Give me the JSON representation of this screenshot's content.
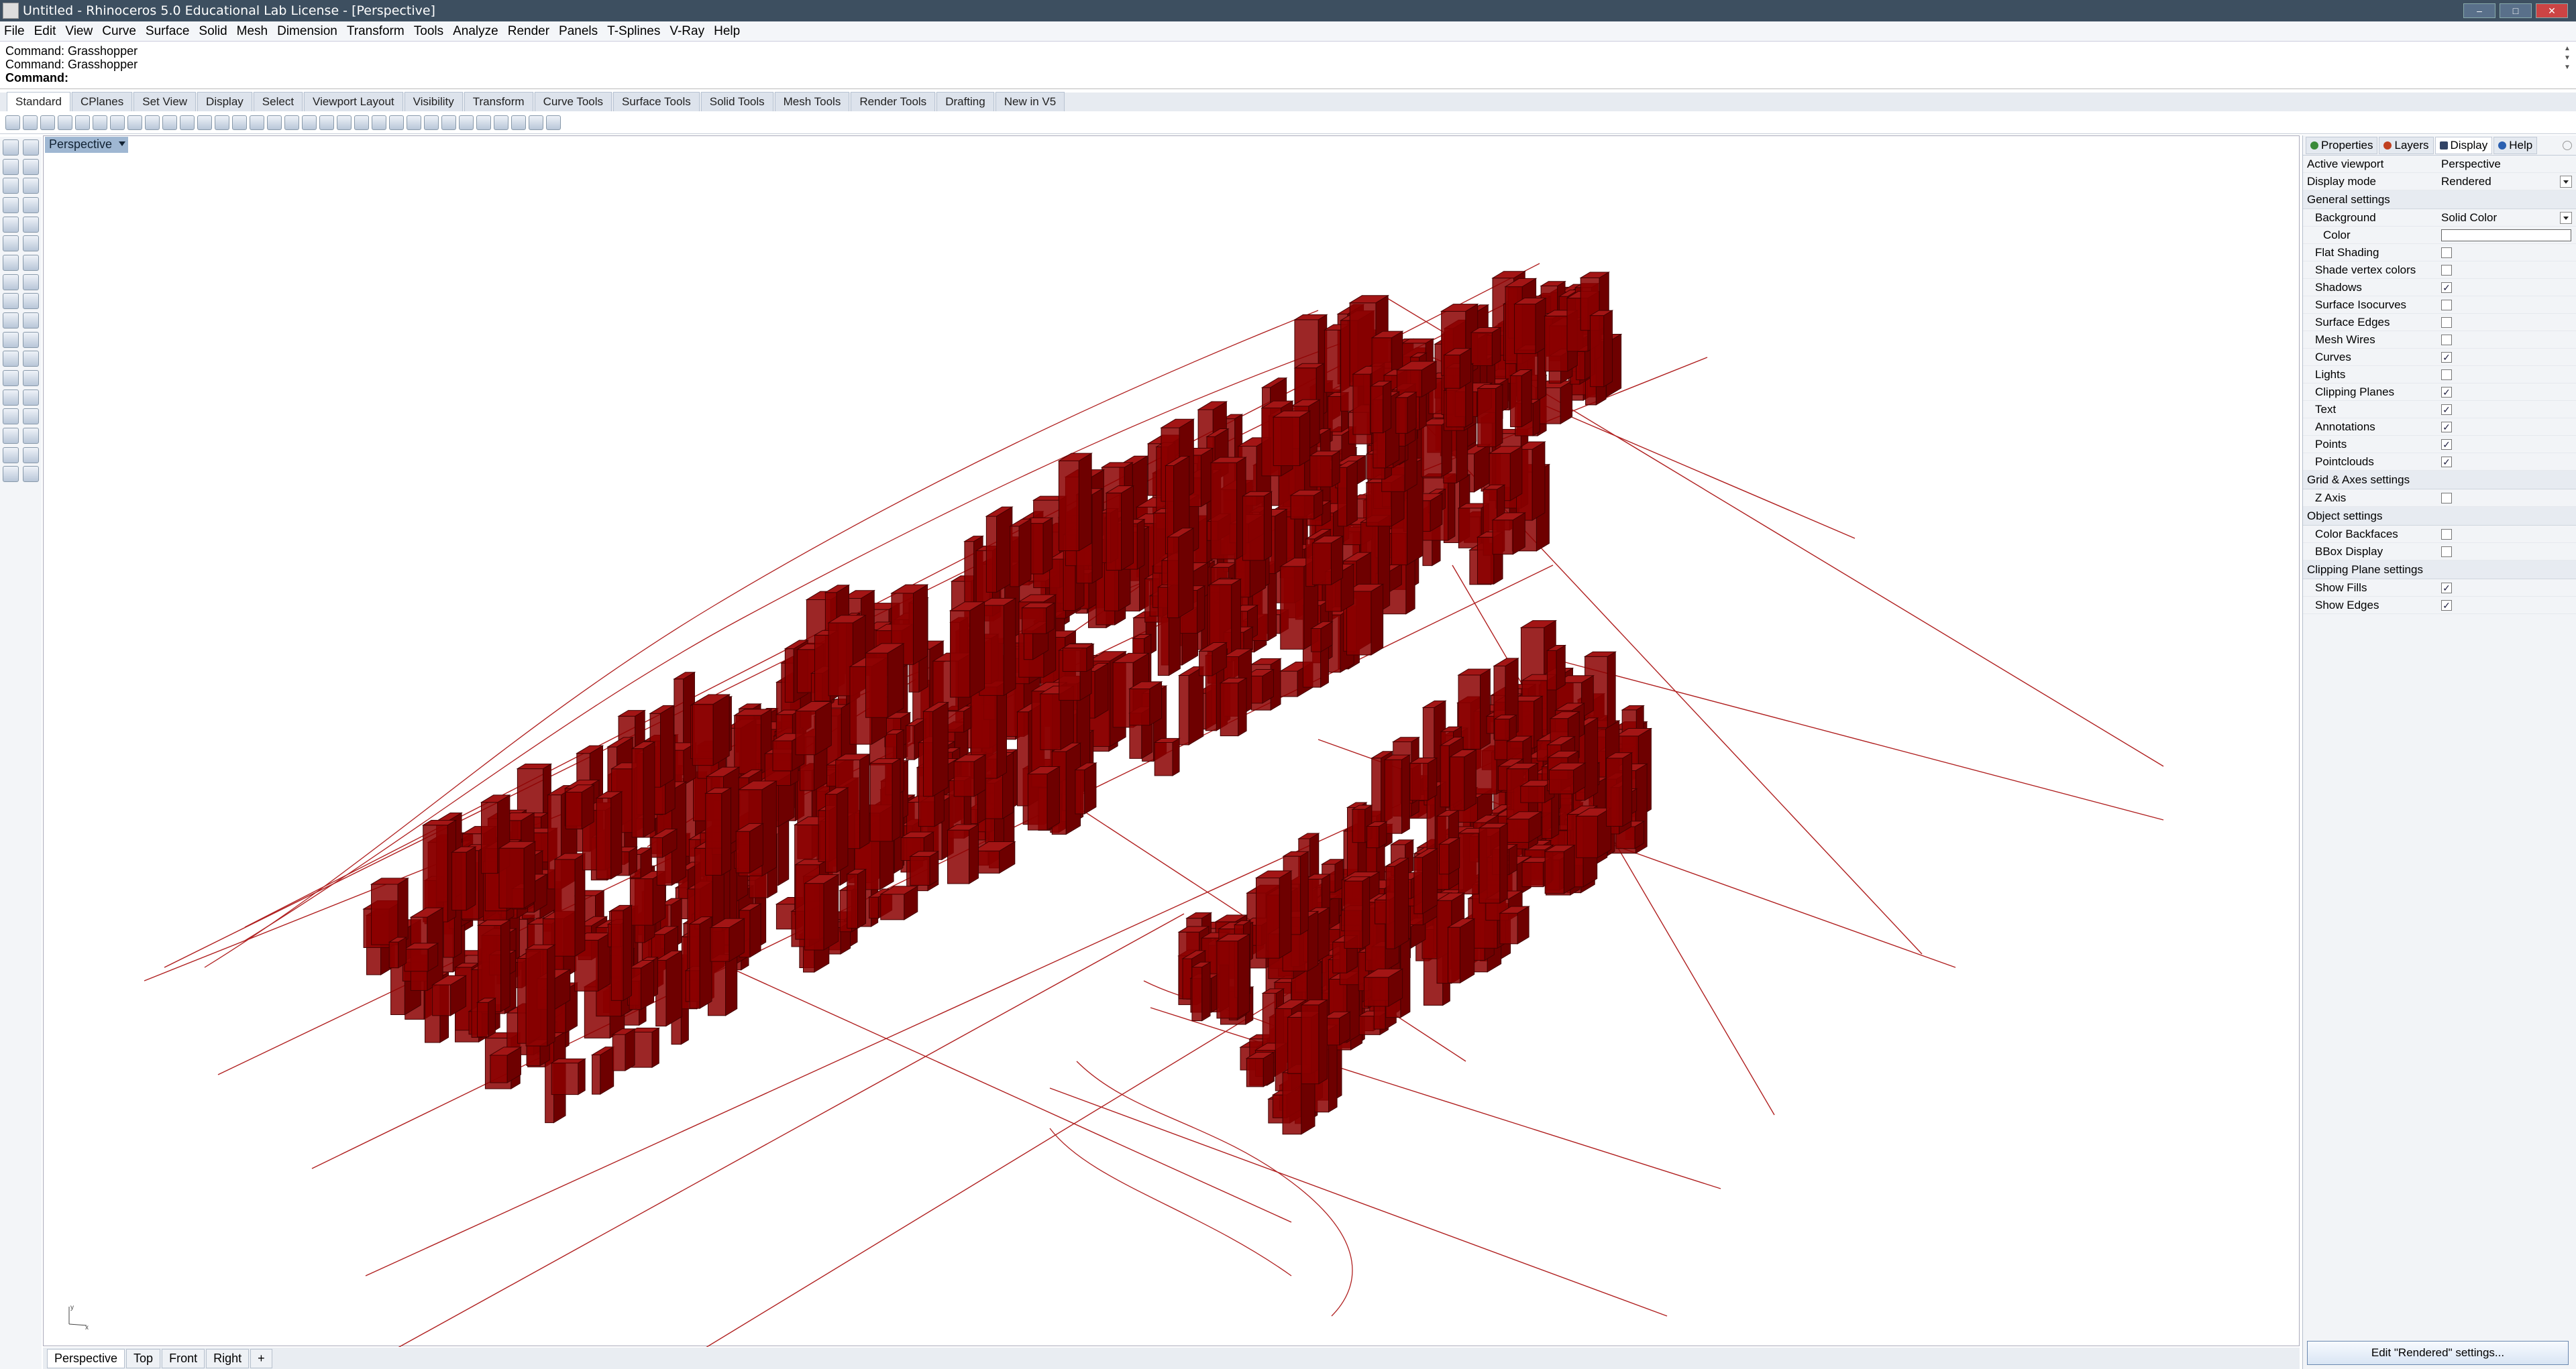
{
  "window": {
    "title": "Untitled - Rhinoceros 5.0 Educational Lab License - [Perspective]"
  },
  "menu": [
    "File",
    "Edit",
    "View",
    "Curve",
    "Surface",
    "Solid",
    "Mesh",
    "Dimension",
    "Transform",
    "Tools",
    "Analyze",
    "Render",
    "Panels",
    "T-Splines",
    "V-Ray",
    "Help"
  ],
  "command_history": [
    "Command: Grasshopper",
    "Command: Grasshopper"
  ],
  "command_prompt": "Command:",
  "toolbar_tabs": [
    "Standard",
    "CPlanes",
    "Set View",
    "Display",
    "Select",
    "Viewport Layout",
    "Visibility",
    "Transform",
    "Curve Tools",
    "Surface Tools",
    "Solid Tools",
    "Mesh Tools",
    "Render Tools",
    "Drafting",
    "New in V5"
  ],
  "active_toolbar_tab": "Standard",
  "viewport": {
    "name": "Perspective",
    "axis_labels": {
      "x": "x",
      "y": "y"
    }
  },
  "viewport_tabs": [
    "Perspective",
    "Top",
    "Front",
    "Right"
  ],
  "add_viewport_tab": "+",
  "scene": {
    "model_color": "#8b0000",
    "line_color": "#b02020",
    "background": "#ffffff"
  },
  "panel": {
    "tabs": [
      {
        "label": "Properties",
        "icon": "properties-icon",
        "color": "#3a8a3a"
      },
      {
        "label": "Layers",
        "icon": "layers-icon",
        "color": "#c04020"
      },
      {
        "label": "Display",
        "icon": "display-icon",
        "color": "#334466"
      },
      {
        "label": "Help",
        "icon": "help-icon",
        "color": "#2a5fb0"
      }
    ],
    "active_tab": "Display",
    "active_viewport_label": "Active viewport",
    "active_viewport_value": "Perspective",
    "display_mode_label": "Display mode",
    "display_mode_value": "Rendered",
    "general_settings": "General settings",
    "background_label": "Background",
    "background_value": "Solid Color",
    "color_label": "Color",
    "general_items": [
      {
        "label": "Flat Shading",
        "checked": false
      },
      {
        "label": "Shade vertex colors",
        "checked": false
      },
      {
        "label": "Shadows",
        "checked": true
      },
      {
        "label": "Surface Isocurves",
        "checked": false
      },
      {
        "label": "Surface Edges",
        "checked": false
      },
      {
        "label": "Mesh Wires",
        "checked": false
      },
      {
        "label": "Curves",
        "checked": true
      },
      {
        "label": "Lights",
        "checked": false
      },
      {
        "label": "Clipping Planes",
        "checked": true
      },
      {
        "label": "Text",
        "checked": true
      },
      {
        "label": "Annotations",
        "checked": true
      },
      {
        "label": "Points",
        "checked": true
      },
      {
        "label": "Pointclouds",
        "checked": true
      }
    ],
    "grid_settings": "Grid & Axes settings",
    "grid_items": [
      {
        "label": "Z Axis",
        "checked": false
      }
    ],
    "object_settings": "Object settings",
    "object_items": [
      {
        "label": "Color Backfaces",
        "checked": false
      },
      {
        "label": "BBox Display",
        "checked": false
      }
    ],
    "clipping_settings": "Clipping Plane settings",
    "clipping_items": [
      {
        "label": "Show Fills",
        "checked": true
      },
      {
        "label": "Show Edges",
        "checked": true
      }
    ],
    "edit_button": "Edit \"Rendered\" settings..."
  }
}
